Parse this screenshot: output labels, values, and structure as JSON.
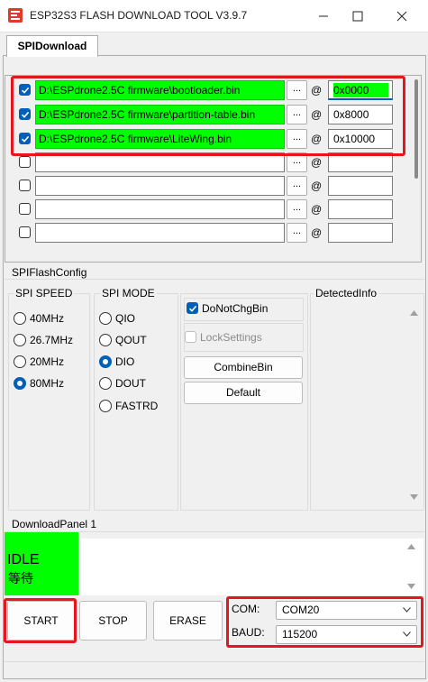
{
  "window": {
    "title": "ESP32S3 FLASH DOWNLOAD TOOL V3.9.7",
    "tab": "SPIDownload"
  },
  "files": [
    {
      "checked": true,
      "path": "D:\\ESPdrone2.5C firmware\\bootloader.bin",
      "address": "0x0000",
      "highlight": true
    },
    {
      "checked": true,
      "path": "D:\\ESPdrone2.5C firmware\\partition-table.bin",
      "address": "0x8000",
      "highlight": true
    },
    {
      "checked": true,
      "path": "D:\\ESPdrone2.5C firmware\\LiteWing.bin",
      "address": "0x10000",
      "highlight": true
    },
    {
      "checked": false,
      "path": "",
      "address": "",
      "highlight": false
    },
    {
      "checked": false,
      "path": "",
      "address": "",
      "highlight": false
    },
    {
      "checked": false,
      "path": "",
      "address": "",
      "highlight": false
    },
    {
      "checked": false,
      "path": "",
      "address": "",
      "highlight": false
    }
  ],
  "browse_label": "...",
  "at_symbol": "@",
  "spi_config": {
    "group_title": "SPIFlashConfig",
    "speed_title": "SPI SPEED",
    "speed_options": [
      "40MHz",
      "26.7MHz",
      "20MHz",
      "80MHz"
    ],
    "speed_selected": "80MHz",
    "mode_title": "SPI MODE",
    "mode_options": [
      "QIO",
      "QOUT",
      "DIO",
      "DOUT",
      "FASTRD"
    ],
    "mode_selected": "DIO",
    "do_not_chg_bin": "DoNotChgBin",
    "lock_settings": "LockSettings",
    "combine_bin": "CombineBin",
    "default": "Default",
    "detected_info": "DetectedInfo"
  },
  "download_panel": {
    "title": "DownloadPanel 1",
    "status_en": "IDLE",
    "status_cn": "等待",
    "start": "START",
    "stop": "STOP",
    "erase": "ERASE",
    "com_label": "COM:",
    "com_value": "COM20",
    "baud_label": "BAUD:",
    "baud_value": "115200"
  },
  "colors": {
    "green": "#00ff00",
    "accent": "#005fb8",
    "annotation_red": "#e8141e"
  }
}
